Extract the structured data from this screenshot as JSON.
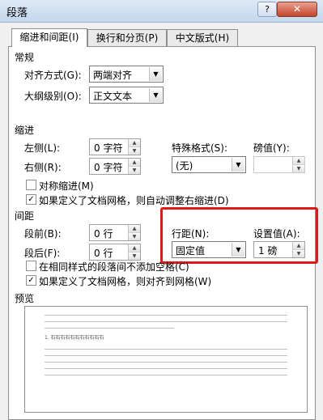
{
  "window": {
    "title": "段落",
    "help_label": "?",
    "close_label": "✕"
  },
  "tabs": [
    {
      "label": "缩进和间距(I)",
      "active": true
    },
    {
      "label": "换行和分页(P)",
      "active": false
    },
    {
      "label": "中文版式(H)",
      "active": false
    }
  ],
  "general": {
    "heading": "常规",
    "alignment_label": "对齐方式(G):",
    "alignment_value": "两端对齐",
    "outline_label": "大纲级别(O):",
    "outline_value": "正文文本"
  },
  "indent": {
    "heading": "缩进",
    "left_label": "左侧(L):",
    "left_value": "0 字符",
    "right_label": "右侧(R):",
    "right_value": "0 字符",
    "special_label": "特殊格式(S):",
    "special_value": "(无)",
    "by_label": "磅值(Y):",
    "by_value": "",
    "mirror_label": "对称缩进(M)",
    "mirror_checked": false,
    "auto_adjust_label": "如果定义了文档网格，则自动调整右缩进(D)",
    "auto_adjust_checked": true
  },
  "spacing": {
    "heading": "间距",
    "before_label": "段前(B):",
    "before_value": "0 行",
    "after_label": "段后(F):",
    "after_value": "0 行",
    "line_spacing_label": "行距(N):",
    "line_spacing_value": "固定值",
    "at_label": "设置值(A):",
    "at_value": "1 磅",
    "no_space_same_style_label": "在相同样式的段落间不添加空格(C)",
    "no_space_same_style_checked": false,
    "snap_grid_label": "如果定义了文档网格，则对齐到网格(W)",
    "snap_grid_checked": true
  },
  "preview": {
    "heading": "预览",
    "sample_text": "1. 石石石石石石石石石石石"
  },
  "icons": {
    "check": "✓",
    "dropdown": "▼",
    "spin_up": "▲",
    "spin_down": "▼"
  }
}
